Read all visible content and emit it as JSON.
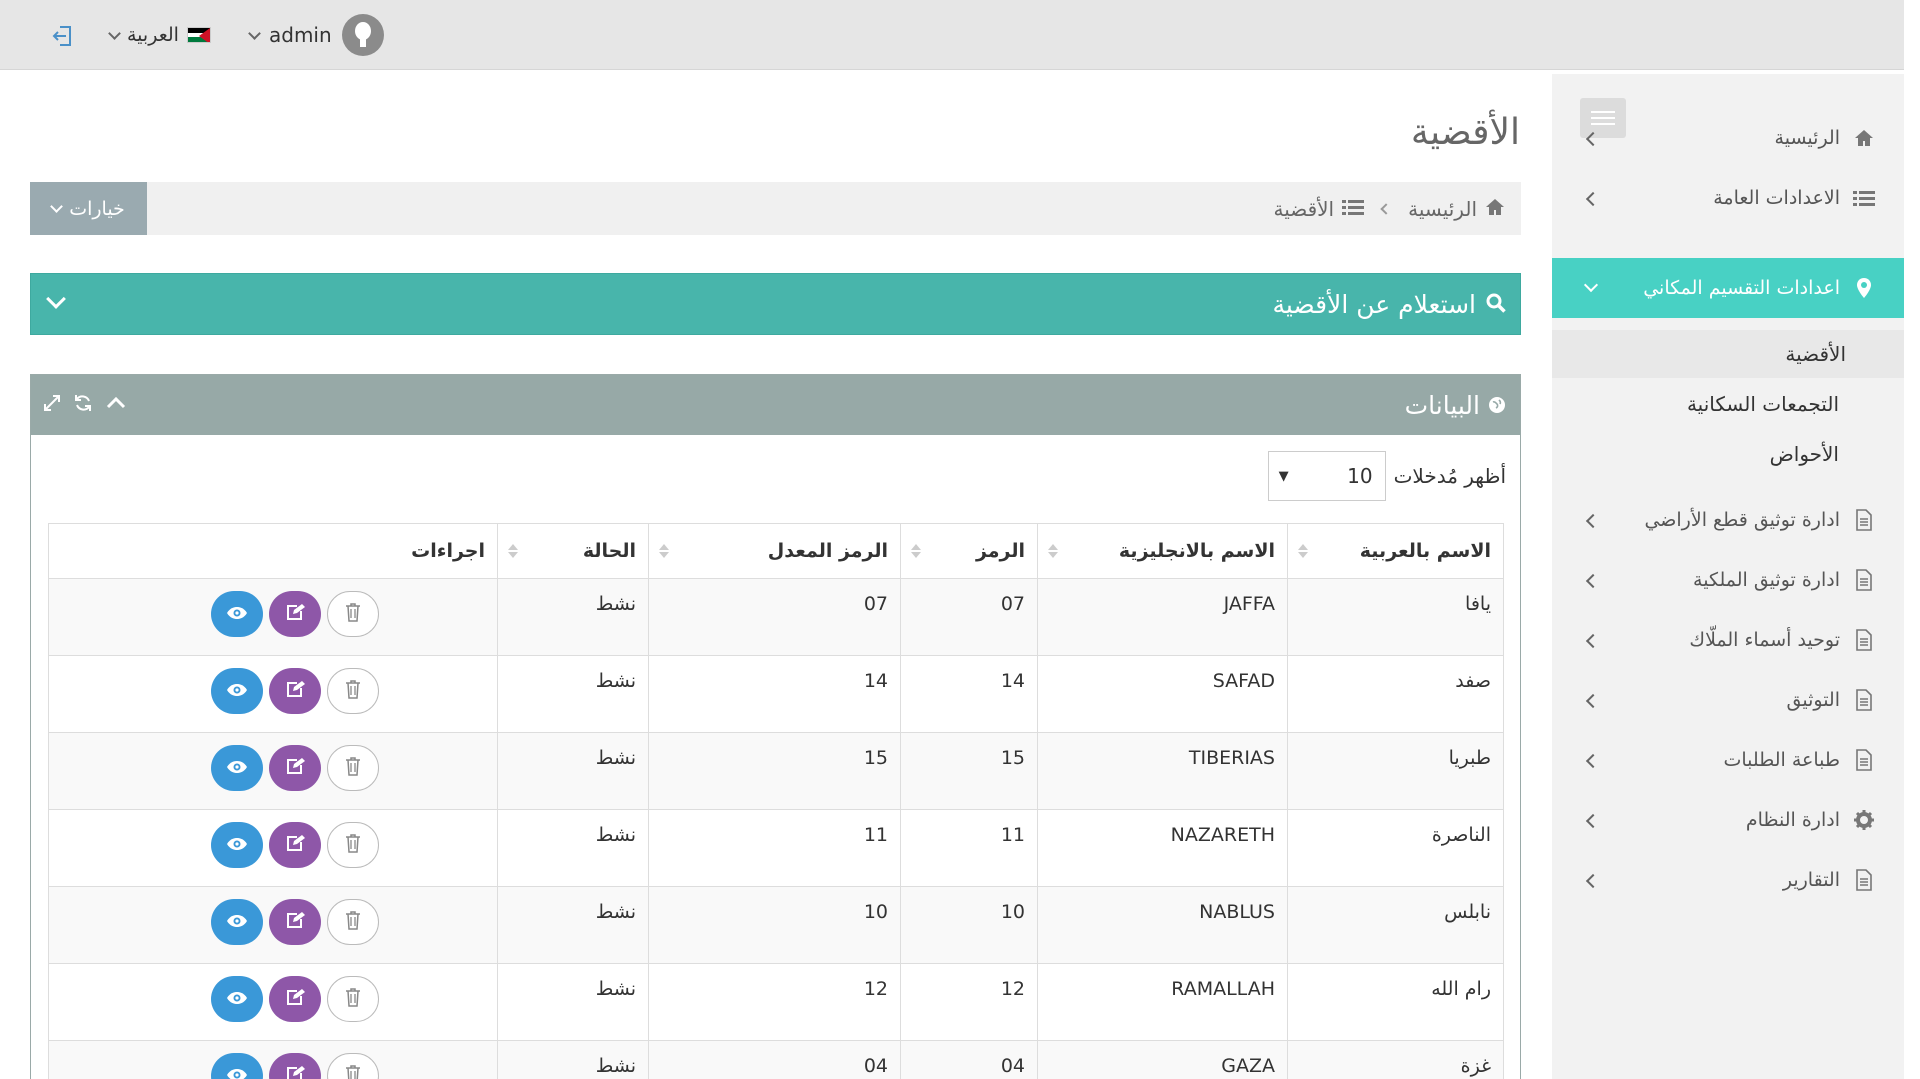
{
  "header": {
    "language": "العربية",
    "username": "admin"
  },
  "sidebar": {
    "items": [
      {
        "label": "الرئيسية",
        "icon": "home-icon"
      },
      {
        "label": "الاعدادات العامة",
        "icon": "list-icon"
      },
      {
        "label": "اعدادات التقسيم المكاني",
        "icon": "map-marker-icon",
        "active": true
      },
      {
        "label": "ادارة توثيق قطع الأراضي",
        "icon": "document-icon"
      },
      {
        "label": "ادارة توثيق الملكية",
        "icon": "document-icon"
      },
      {
        "label": "توحيد أسماء الملّاك",
        "icon": "document-icon"
      },
      {
        "label": "التوثيق",
        "icon": "document-icon"
      },
      {
        "label": "طباعة الطلبات",
        "icon": "document-icon"
      },
      {
        "label": "ادارة النظام",
        "icon": "gear-icon"
      },
      {
        "label": "التقارير",
        "icon": "document-icon"
      }
    ],
    "subitems": [
      {
        "label": "الأقضية",
        "selected": true
      },
      {
        "label": "التجمعات السكانية"
      },
      {
        "label": "الأحواض"
      }
    ]
  },
  "page": {
    "title": "الأقضية",
    "options_label": "خيارات",
    "breadcrumb": [
      "الرئيسية",
      "الأقضية"
    ]
  },
  "search_panel": {
    "title": "استعلام عن الأقضية"
  },
  "data_panel": {
    "title": "البيانات",
    "show_entries_label": "أظهر مُدخلات",
    "page_length": "10",
    "columns": [
      "الاسم بالعربية",
      "الاسم بالانجليزية",
      "الرمز",
      "الرمز المعدل",
      "الحالة",
      "اجراءات"
    ],
    "rows": [
      {
        "ar": "يافا",
        "en": "JAFFA",
        "code": "07",
        "mod_code": "07",
        "status": "نشط"
      },
      {
        "ar": "صفد",
        "en": "SAFAD",
        "code": "14",
        "mod_code": "14",
        "status": "نشط"
      },
      {
        "ar": "طبريا",
        "en": "TIBERIAS",
        "code": "15",
        "mod_code": "15",
        "status": "نشط"
      },
      {
        "ar": "الناصرة",
        "en": "NAZARETH",
        "code": "11",
        "mod_code": "11",
        "status": "نشط"
      },
      {
        "ar": "نابلس",
        "en": "NABLUS",
        "code": "10",
        "mod_code": "10",
        "status": "نشط"
      },
      {
        "ar": "رام الله",
        "en": "RAMALLAH",
        "code": "12",
        "mod_code": "12",
        "status": "نشط"
      },
      {
        "ar": "غزة",
        "en": "GAZA",
        "code": "04",
        "mod_code": "04",
        "status": "نشط"
      }
    ]
  },
  "colors": {
    "teal_active": "#48d1c4",
    "search_panel": "#48b5ab",
    "data_header": "#97a9a7",
    "view_button": "#3a98d8",
    "edit_button": "#8e57a8"
  }
}
